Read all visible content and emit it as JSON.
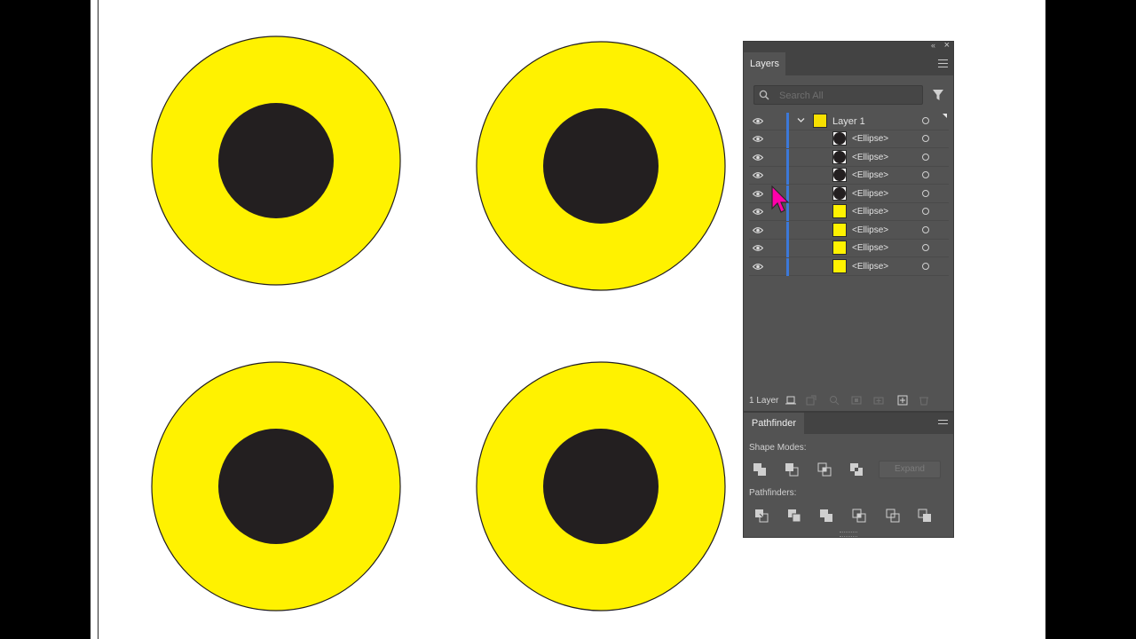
{
  "colors": {
    "accent_yellow": "#fff200",
    "pupil": "#231f20",
    "layer_color": "#3c78d8",
    "cursor": "#ff00aa"
  },
  "layers_panel": {
    "tab_label": "Layers",
    "search_placeholder": "Search All",
    "top_layer": {
      "name": "Layer 1",
      "expanded": true
    },
    "items": [
      {
        "label": "<Ellipse>",
        "swatch": "black"
      },
      {
        "label": "<Ellipse>",
        "swatch": "black"
      },
      {
        "label": "<Ellipse>",
        "swatch": "black"
      },
      {
        "label": "<Ellipse>",
        "swatch": "black"
      },
      {
        "label": "<Ellipse>",
        "swatch": "yellow"
      },
      {
        "label": "<Ellipse>",
        "swatch": "yellow"
      },
      {
        "label": "<Ellipse>",
        "swatch": "yellow"
      },
      {
        "label": "<Ellipse>",
        "swatch": "yellow"
      }
    ],
    "footer_count": "1 Layer"
  },
  "pathfinder_panel": {
    "tab_label": "Pathfinder",
    "shape_modes_label": "Shape Modes:",
    "expand_label": "Expand",
    "pathfinders_label": "Pathfinders:"
  }
}
